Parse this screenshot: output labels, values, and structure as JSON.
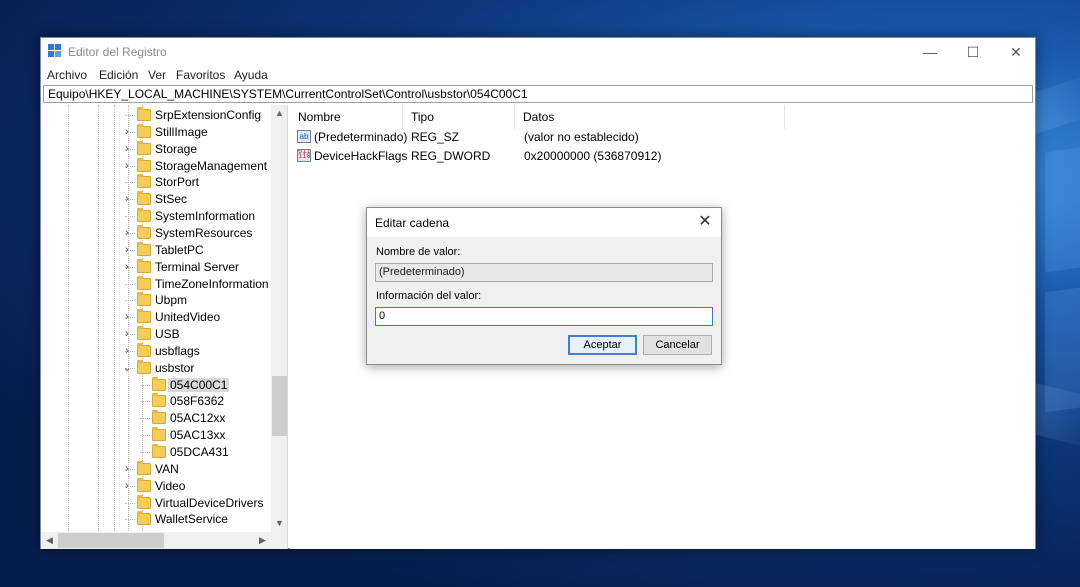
{
  "window": {
    "title": "Editor del Registro",
    "minimize_glyph": "—",
    "maximize_glyph": "☐",
    "close_glyph": "✕"
  },
  "menu": [
    "Archivo",
    "Edición",
    "Ver",
    "Favoritos",
    "Ayuda"
  ],
  "address": "Equipo\\HKEY_LOCAL_MACHINE\\SYSTEM\\CurrentControlSet\\Control\\usbstor\\054C00C1",
  "tree": {
    "items": [
      {
        "label": "SrpExtensionConfig",
        "expander": ""
      },
      {
        "label": "StillImage",
        "expander": "›"
      },
      {
        "label": "Storage",
        "expander": "›"
      },
      {
        "label": "StorageManagement",
        "expander": "›"
      },
      {
        "label": "StorPort",
        "expander": ""
      },
      {
        "label": "StSec",
        "expander": "›"
      },
      {
        "label": "SystemInformation",
        "expander": ""
      },
      {
        "label": "SystemResources",
        "expander": "›"
      },
      {
        "label": "TabletPC",
        "expander": "›"
      },
      {
        "label": "Terminal Server",
        "expander": "›"
      },
      {
        "label": "TimeZoneInformation",
        "expander": ""
      },
      {
        "label": "Ubpm",
        "expander": ""
      },
      {
        "label": "UnitedVideo",
        "expander": "›"
      },
      {
        "label": "USB",
        "expander": "›"
      },
      {
        "label": "usbflags",
        "expander": "›"
      },
      {
        "label": "usbstor",
        "expander": "⌄"
      },
      {
        "label": "054C00C1",
        "expander": "",
        "child": true,
        "selected": true
      },
      {
        "label": "058F6362",
        "expander": "",
        "child": true
      },
      {
        "label": "05AC12xx",
        "expander": "",
        "child": true
      },
      {
        "label": "05AC13xx",
        "expander": "",
        "child": true
      },
      {
        "label": "05DCA431",
        "expander": "",
        "child": true
      },
      {
        "label": "VAN",
        "expander": "›"
      },
      {
        "label": "Video",
        "expander": "›"
      },
      {
        "label": "VirtualDeviceDrivers",
        "expander": ""
      },
      {
        "label": "WalletService",
        "expander": ""
      }
    ],
    "scroll_up": "▲",
    "scroll_down": "▼",
    "scroll_left": "◀",
    "scroll_right": "▶"
  },
  "list": {
    "columns": [
      "Nombre",
      "Tipo",
      "Datos"
    ],
    "rows": [
      {
        "icon": "string-value-icon",
        "icon_text": "ab",
        "name": "(Predeterminado)",
        "type": "REG_SZ",
        "data": "(valor no establecido)"
      },
      {
        "icon": "binary-value-icon",
        "icon_text": "011 110",
        "name": "DeviceHackFlags",
        "type": "REG_DWORD",
        "data": "0x20000000 (536870912)"
      }
    ]
  },
  "dialog": {
    "title": "Editar cadena",
    "close_glyph": "✕",
    "name_label": "Nombre de valor:",
    "name_value": "(Predeterminado)",
    "data_label": "Información del valor:",
    "data_value": "0",
    "ok_label": "Aceptar",
    "cancel_label": "Cancelar"
  },
  "colors": {
    "accent": "#3c7fd4",
    "folder": "#f4cc59",
    "desktop": "#0c3477"
  }
}
